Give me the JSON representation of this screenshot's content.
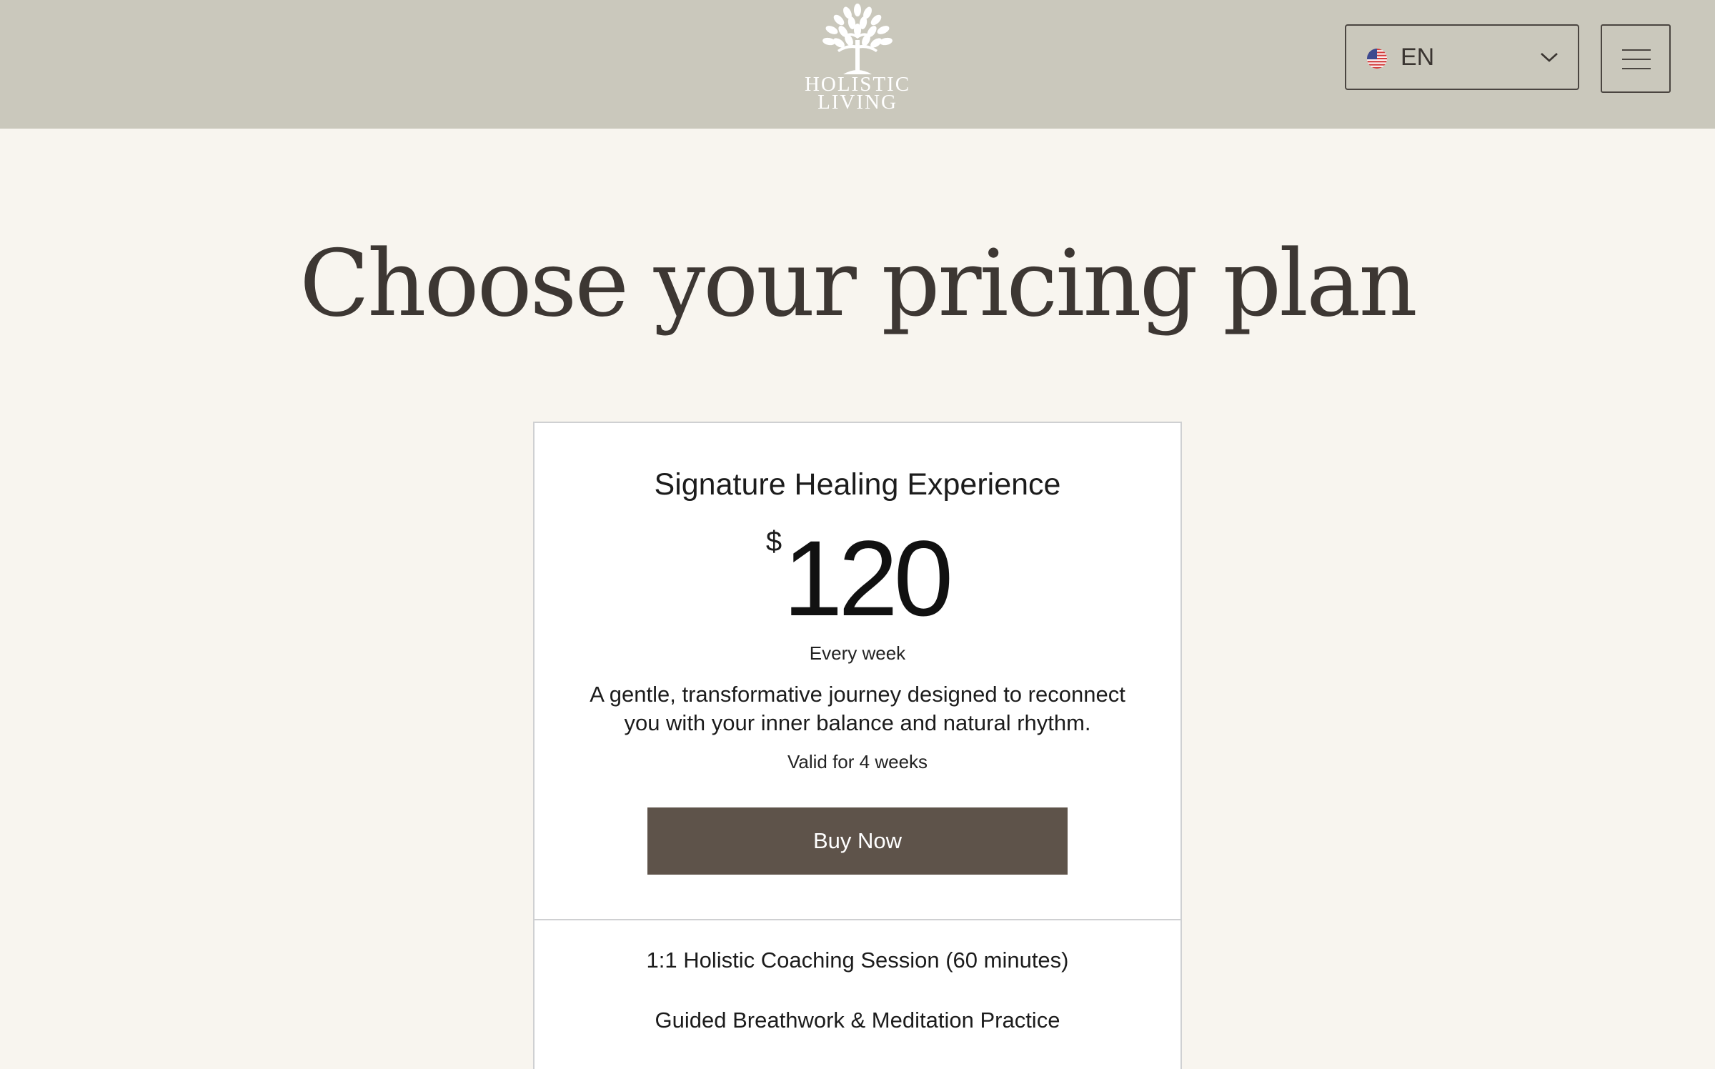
{
  "header": {
    "logo": {
      "line1": "HOLISTIC",
      "line2": "LIVING",
      "icon": "tree-icon"
    },
    "language": {
      "flag_icon": "us-flag-icon",
      "selected": "EN"
    },
    "menu": {
      "icon": "hamburger-menu-icon"
    }
  },
  "main": {
    "title": "Choose your pricing plan"
  },
  "plan": {
    "name": "Signature Healing Experience",
    "currency": "$",
    "amount": "120",
    "frequency": "Every week",
    "description": "A gentle, transformative journey designed to reconnect you with your inner balance and natural rhythm.",
    "validity": "Valid for 4 weeks",
    "buy_label": "Buy Now",
    "features": [
      "1:1 Holistic Coaching Session (60 minutes)",
      "Guided Breathwork & Meditation Practice"
    ]
  },
  "colors": {
    "header_bg": "#cac8bc",
    "page_bg": "#f8f5ef",
    "button_bg": "#5e534a",
    "title_text": "#3d3733"
  }
}
